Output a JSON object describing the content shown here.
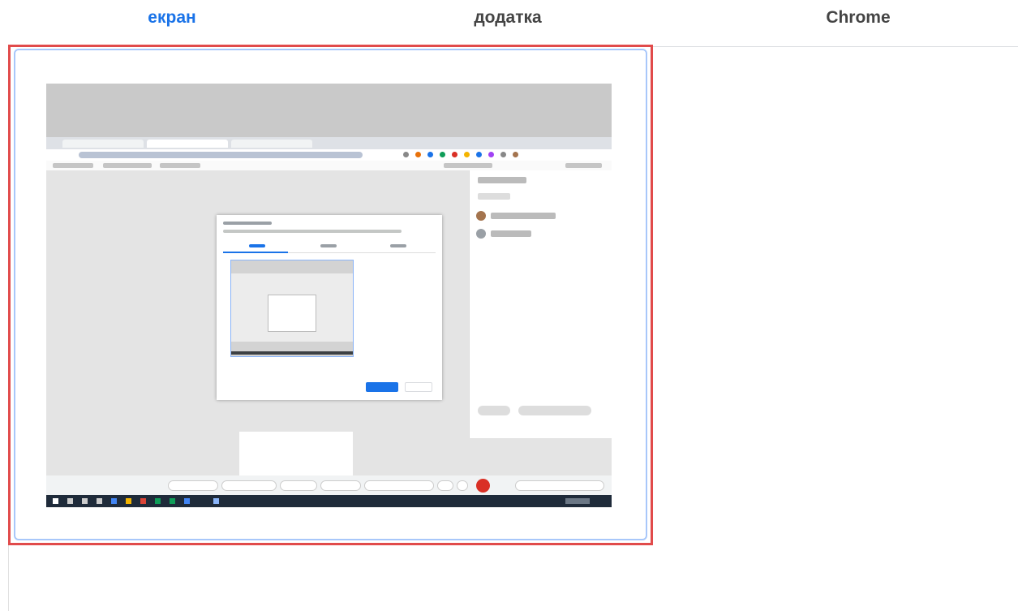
{
  "tabs": [
    {
      "label": "екран",
      "active": true
    },
    {
      "label": "додатка",
      "active": false
    },
    {
      "label": "Chrome",
      "active": false
    }
  ],
  "colors": {
    "accent": "#1a73e8",
    "highlight": "#e14b4b",
    "selected_border": "#a8c7fa"
  },
  "preview": {
    "description_icon": "screen-thumbnail"
  }
}
